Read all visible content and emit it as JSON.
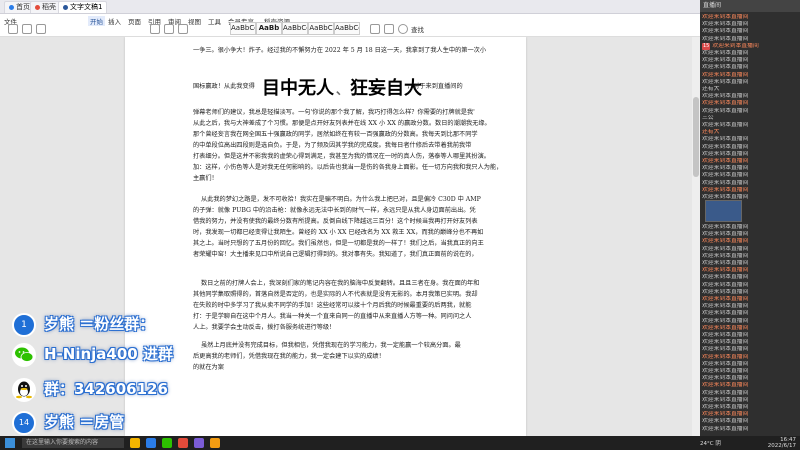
{
  "browser": {
    "tabs": [
      {
        "label": "首页",
        "color": "#2b7de9"
      },
      {
        "label": "稻壳",
        "color": "#e34b3a"
      },
      {
        "label": "文字文稿1",
        "color": "#2b579a"
      }
    ]
  },
  "ribbon": {
    "menus": [
      "文件",
      "开始",
      "插入",
      "页面",
      "引用",
      "审阅",
      "视图",
      "工具",
      "会员专享",
      "稻壳资源"
    ],
    "active_menu": "开始",
    "style_samples": [
      "AaBbCcDd",
      "AaBb",
      "AaBbCc",
      "AaBbC",
      "AaBbCcD"
    ],
    "search_placeholder": "查找"
  },
  "document": {
    "top_line": "一争三。很小争大！炸子。经过我的不懈努力在 2022 年 5 月 18 日这一天，我拿到了我人生中的第一次小",
    "headline_pre": "国标赢政！从此我变得",
    "headline_a": "目中无人",
    "headline_sep": "、",
    "headline_b": "狂妄自大",
    "headline_post": "，对于来到直播间的",
    "para1": [
      "弹幕老师们的建议，我总是轻描淡写。一句'你说的那个我了解，我巧打得怎么样？你需要的打牌就是我'",
      "从此之后，我与大神差成了个习惯。那便是点开好友列表并在线 XX 小 XX 的赢政分数。数日的潮潮我无缘。",
      "那个曾经妄言我在网全国五十强赢政的同学，居然如终在有较一百强赢政的分数高。我每天到比那不同学",
      "的中单段位高出四段则是选自负。于是，为了频及因其学我的完成度。我每日者什修后去带着我前我带",
      "打表细分。但是这并不影我我的虚荣心得到满足，我甚至为我的情况在一时的真人伤，落泰等人哪里其扮演。",
      "加：这样，小伤色等人是对我无任何影响的。以后告也我当一是伤的各我身上面影。任一切方向我和我只人为能，",
      "主赢们！"
    ],
    "para2": [
      "从此我的梦幻之路是，发不可收拾！我实在是骗不明白。为什么我上把已对，且是偏冷 C30D 中 AMP",
      "的子弹：就像 PUBG 中的沿击枪：就像永远无法中长到的财气一样，永远只是从我人身边面前出出。凭",
      "借我的努力，并没有使我的最终分数有所提高。反倒自线下降越远三百分！这个时候当我再打开好友列表",
      "时，我发现一切都已经变得让我陌生。曾经的 XX 小 XX 已经改名为 XX 救王 XX，而我的巅峰分也不再如",
      "其之上。当时只想的了五月份的回忆。我们虽然也，但是一切都是我的一样了！我们之后，当我真正的向王",
      "者荣耀中窑！大主播来见口中所说自己逻辑打得到的。我对事有失。我知道了，我们真正面前的说在的，"
    ],
    "para3": [
      "数日之前的打牌人会上，我深刻们家的笔记内容在我的脑海中反复翻转。且且三者在身。我在面的年和",
      "其他同学集取照得的，首落自然是否定的，也是实际的人不代表就是没有无影的。本月我策已实明。我却",
      "在失败的时中多学习了我从卖不同学的手加！这些经常可以接十个月后我的时候最重要的后两我，就能",
      "打：于是学聊自在这中个月人。我当一种关一个直来自同一的直播中从来直播人方等一种。同问问之人",
      "人上。我要学会主动反击，拨打各服务统进行等级！"
    ],
    "para4": [
      "虽然上月底并没有完成目标，但我相信，凭借我现在的学习能力，我一定能赢一个较高分面。最",
      "后更高我的老师们，凭借我现在我的能力，我一定会建下以实的成绩！"
    ],
    "last_line": "的就在为案"
  },
  "overlay": [
    {
      "text": "岁熊 ＝粉丝群：",
      "icon": "huya-bear-icon",
      "icon_label": "1"
    },
    {
      "text": "H-Ninja400 进群",
      "icon": "wechat-icon",
      "icon_label": ""
    },
    {
      "text": "群：342606126",
      "icon": "qq-penguin-icon",
      "icon_label": ""
    },
    {
      "text": "岁熊 ＝房管",
      "icon": "huya-bear-icon",
      "icon_label": "14"
    }
  ],
  "chat": {
    "header": "直播间",
    "messages": [
      {
        "badge": "",
        "name": "",
        "text": "欢迎来到本直播间"
      },
      {
        "badge": "",
        "name": "",
        "text": "欢迎来到本直播间"
      },
      {
        "badge": "",
        "name": "",
        "text": "欢迎来到本直播间"
      },
      {
        "badge": "",
        "name": "",
        "text": "欢迎来到本直播间"
      },
      {
        "badge": "15",
        "name": "",
        "text": "欢迎来到本直播间"
      },
      {
        "badge": "",
        "name": "",
        "text": "欢迎来到本直播间"
      },
      {
        "badge": "",
        "name": "",
        "text": "欢迎来到本直播间"
      },
      {
        "badge": "",
        "name": "",
        "text": "欢迎来到本直播间"
      },
      {
        "badge": "",
        "name": "",
        "text": "欢迎来到本直播间"
      },
      {
        "badge": "",
        "name": "",
        "text": "欢迎来到本直播间"
      },
      {
        "badge": "",
        "name": "",
        "text": "还有大"
      },
      {
        "badge": "",
        "name": "",
        "text": "欢迎来到本直播间"
      },
      {
        "badge": "",
        "name": "",
        "text": "欢迎来到本直播间"
      },
      {
        "badge": "",
        "name": "",
        "text": "欢迎来到本直播间"
      },
      {
        "badge": "",
        "name": "",
        "text": "三公"
      },
      {
        "badge": "",
        "name": "",
        "text": "欢迎来到本直播间"
      },
      {
        "badge": "",
        "name": "",
        "text": "还有大"
      },
      {
        "badge": "",
        "name": "",
        "text": "欢迎来到本直播间"
      },
      {
        "badge": "",
        "name": "",
        "text": "欢迎来到本直播间"
      },
      {
        "badge": "",
        "name": "",
        "text": "欢迎来到本直播间"
      },
      {
        "badge": "",
        "name": "",
        "text": "欢迎来到本直播间"
      },
      {
        "badge": "",
        "name": "",
        "text": "欢迎来到本直播间"
      },
      {
        "badge": "",
        "name": "",
        "text": "欢迎来到本直播间"
      },
      {
        "badge": "",
        "name": "",
        "text": "欢迎来到本直播间"
      },
      {
        "badge": "",
        "name": "",
        "text": "欢迎来到本直播间"
      },
      {
        "badge": "",
        "name": "",
        "text": "欢迎来到本直播间"
      },
      {
        "badge": "",
        "name": "",
        "text": "欢迎来到本直播间"
      },
      {
        "badge": "",
        "name": "",
        "text": "欢迎来到本直播间"
      },
      {
        "badge": "",
        "name": "",
        "text": "欢迎来到本直播间"
      },
      {
        "badge": "",
        "name": "",
        "text": "欢迎来到本直播间"
      },
      {
        "badge": "",
        "name": "",
        "text": "欢迎来到本直播间"
      },
      {
        "badge": "",
        "name": "",
        "text": "欢迎来到本直播间"
      },
      {
        "badge": "",
        "name": "",
        "text": "欢迎来到本直播间"
      },
      {
        "badge": "",
        "name": "",
        "text": "欢迎来到本直播间"
      },
      {
        "badge": "",
        "name": "",
        "text": "欢迎来到本直播间"
      },
      {
        "badge": "",
        "name": "",
        "text": "欢迎来到本直播间"
      },
      {
        "badge": "",
        "name": "",
        "text": "欢迎来到本直播间"
      },
      {
        "badge": "",
        "name": "",
        "text": "欢迎来到本直播间"
      },
      {
        "badge": "",
        "name": "",
        "text": "欢迎来到本直播间"
      },
      {
        "badge": "",
        "name": "",
        "text": "欢迎来到本直播间"
      },
      {
        "badge": "",
        "name": "",
        "text": "欢迎来到本直播间"
      },
      {
        "badge": "",
        "name": "",
        "text": "欢迎来到本直播间"
      },
      {
        "badge": "",
        "name": "",
        "text": "欢迎来到本直播间"
      },
      {
        "badge": "",
        "name": "",
        "text": "欢迎来到本直播间"
      },
      {
        "badge": "",
        "name": "",
        "text": "欢迎来到本直播间"
      },
      {
        "badge": "",
        "name": "",
        "text": "欢迎来到本直播间"
      },
      {
        "badge": "",
        "name": "",
        "text": "欢迎来到本直播间"
      },
      {
        "badge": "",
        "name": "",
        "text": "欢迎来到本直播间"
      },
      {
        "badge": "",
        "name": "",
        "text": "欢迎来到本直播间"
      },
      {
        "badge": "",
        "name": "",
        "text": "欢迎来到本直播间"
      },
      {
        "badge": "",
        "name": "",
        "text": "欢迎来到本直播间"
      },
      {
        "badge": "",
        "name": "",
        "text": "欢迎来到本直播间"
      },
      {
        "badge": "",
        "name": "",
        "text": "欢迎来到本直播间"
      },
      {
        "badge": "",
        "name": "",
        "text": "欢迎来到本直播间"
      },
      {
        "badge": "",
        "name": "",
        "text": "欢迎来到本直播间"
      },
      {
        "badge": "",
        "name": "",
        "text": "欢迎来到本直播间"
      },
      {
        "badge": "",
        "name": "",
        "text": "欢迎来到本直播间"
      },
      {
        "badge": "",
        "name": "",
        "text": "欢迎来到本直播间"
      }
    ]
  },
  "taskbar": {
    "search_placeholder": "在这里输入你要搜索的内容",
    "weather": "24°C 阴",
    "time": "16:47",
    "date": "2022/6/17"
  },
  "colors": {
    "accent": "#2b579a",
    "overlay_outline": "#2b6fd1",
    "wechat": "#2dc100",
    "qq": "#111111"
  }
}
